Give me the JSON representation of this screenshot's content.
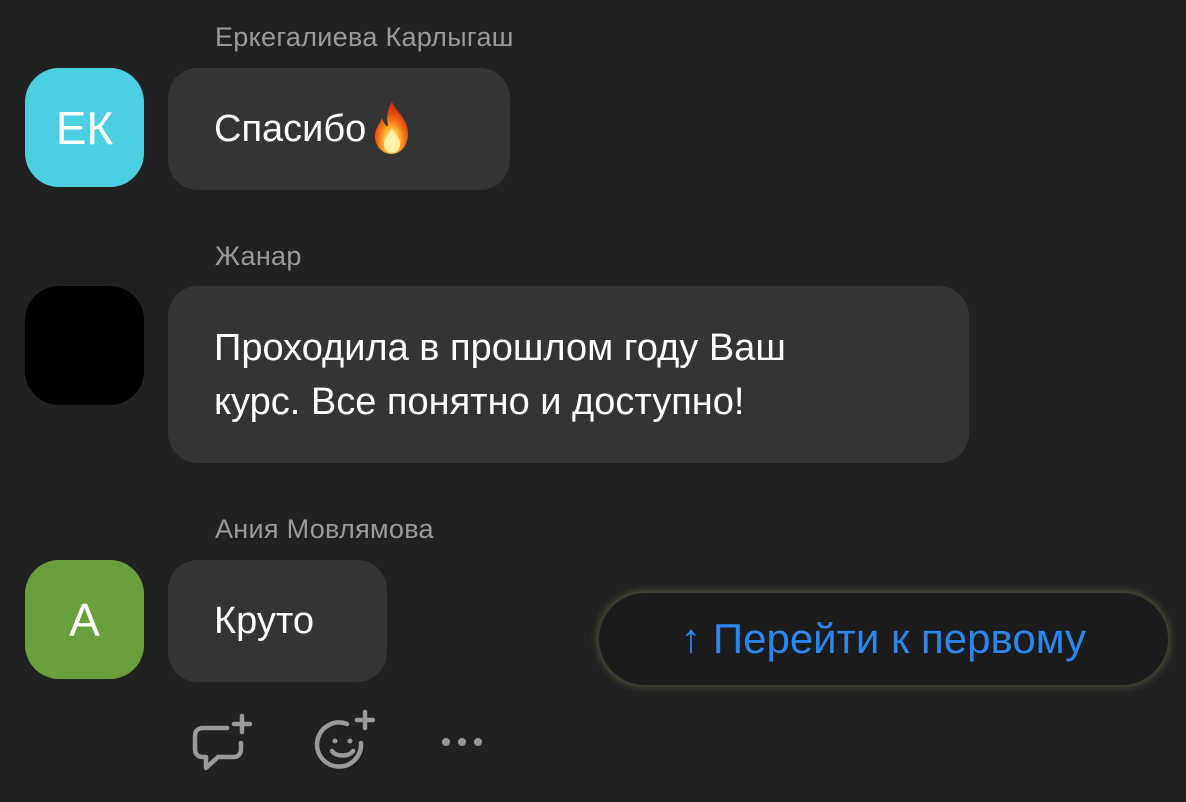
{
  "messages": [
    {
      "author": "Еркегалиева Карлыгаш",
      "avatar": {
        "initials": "ЕК",
        "color": "#4ccfe0"
      },
      "text": "Спасибо",
      "emoji": "fire-emoji"
    },
    {
      "author": "Жанар",
      "avatar": {
        "initials": "",
        "color": "#000000"
      },
      "text_line1": "Проходила в прошлом году Ваш",
      "text_line2": "курс. Все понятно и доступно!"
    },
    {
      "author": "Ания Мовлямова",
      "avatar": {
        "initials": "А",
        "color": "#6a9f3d"
      },
      "text": "Круто"
    }
  ],
  "jump_button": {
    "arrow": "↑",
    "label": "Перейти к первому",
    "color": "#2c86f0"
  },
  "actions": [
    {
      "icon": "comment-add-icon"
    },
    {
      "icon": "reaction-add-icon"
    },
    {
      "icon": "more-icon"
    }
  ],
  "theme": {
    "background": "#212121",
    "bubble": "#343434",
    "author_text": "#9a9a9a"
  }
}
